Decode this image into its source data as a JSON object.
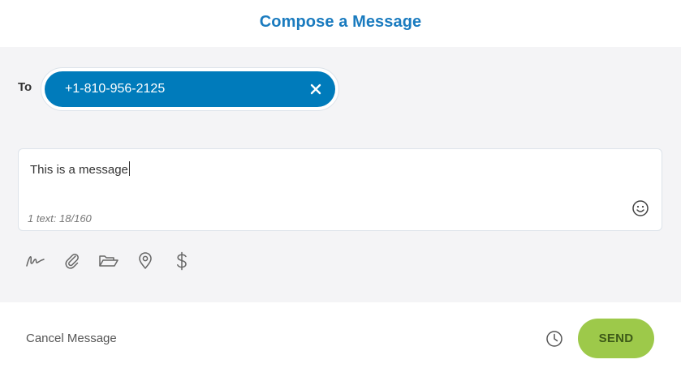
{
  "header": {
    "title": "Compose a Message"
  },
  "recipient": {
    "label": "To",
    "chip_value": "+1-810-956-2125",
    "remove_icon": "close-icon"
  },
  "message": {
    "text": "This is a message",
    "count": "1 text: 18/160",
    "emoji_icon": "smiley-icon"
  },
  "toolbar": {
    "items": [
      {
        "name": "signature",
        "icon": "signature-icon"
      },
      {
        "name": "attach",
        "icon": "paperclip-icon"
      },
      {
        "name": "folder",
        "icon": "folder-open-icon"
      },
      {
        "name": "location",
        "icon": "map-pin-icon"
      },
      {
        "name": "payment",
        "icon": "dollar-icon"
      }
    ]
  },
  "footer": {
    "cancel_label": "Cancel Message",
    "schedule_icon": "clock-icon",
    "send_label": "SEND"
  },
  "colors": {
    "title_blue": "#1a7bbf",
    "chip_blue": "#007bbb",
    "send_green": "#9dc94a",
    "panel_gray": "#f4f4f6"
  }
}
